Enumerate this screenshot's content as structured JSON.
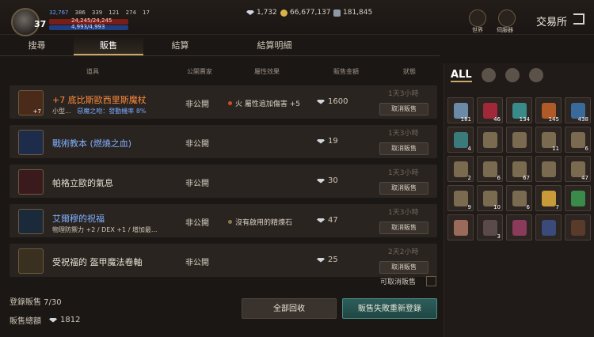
{
  "header": {
    "level": "37",
    "stats": [
      "32,767",
      "386",
      "339",
      "121",
      "274",
      "17"
    ],
    "hp": "24,245/24,245",
    "mp": "4,993/4,993",
    "currency": [
      "1,732",
      "66,677,137",
      "181,845"
    ],
    "icon_labels": [
      "世界",
      "伺服器"
    ],
    "title": "交易所"
  },
  "tabs": [
    "搜尋",
    "販售",
    "結算",
    "結算明細"
  ],
  "columns": [
    "道具",
    "公開賣家",
    "屬性效果",
    "販售金額",
    "狀態"
  ],
  "rows": [
    {
      "name": "+7 底比斯歐西里斯魔杖",
      "sub_pre": "小型...",
      "sub_em": "惡魔之吻：發動機率 8%",
      "public": "非公開",
      "effect": "火 屬性追加傷害 +5",
      "price": "1600",
      "time": "1天3小時",
      "btn": "取消販售",
      "enh": "+7"
    },
    {
      "name": "戰術教本 (燃燒之血)",
      "public": "非公開",
      "effect": "",
      "price": "19",
      "time": "1天3小時",
      "btn": "取消販售"
    },
    {
      "name": "帕格立歐的氣息",
      "public": "非公開",
      "effect": "",
      "price": "30",
      "time": "1天3小時",
      "btn": "取消販售"
    },
    {
      "name": "艾爾穆的祝福",
      "sub_pre": "物理防禦力 +2 / DEX +1 / 增加最...",
      "public": "非公開",
      "effect": "沒有啟用的精煉石",
      "price": "47",
      "time": "1天3小時",
      "btn": "取消販售"
    },
    {
      "name": "受祝福的 盔甲魔法卷軸",
      "public": "非公開",
      "effect": "",
      "price": "25",
      "time": "2天2小時",
      "btn": "取消販售"
    }
  ],
  "footer": {
    "cancel_label": "可取消販售",
    "registered": "登錄販售 7/30",
    "total_label": "販售總額",
    "total": "1812",
    "btn_collect": "全部回收",
    "btn_relist": "販售失敗重新登錄"
  },
  "inventory": {
    "filter_all": "ALL",
    "counts": [
      "181",
      "46",
      "134",
      "145",
      "438",
      "4",
      "",
      "",
      "11",
      "6",
      "2",
      "6",
      "67",
      "",
      "47",
      "9",
      "10",
      "6",
      "7",
      "",
      "",
      "3",
      "",
      ""
    ]
  },
  "colors": {
    "name_orange": "#ff8a3c",
    "name_blue": "#7fb0ff",
    "name_white": "#e8e2d6",
    "accent": "#c9a86a"
  }
}
